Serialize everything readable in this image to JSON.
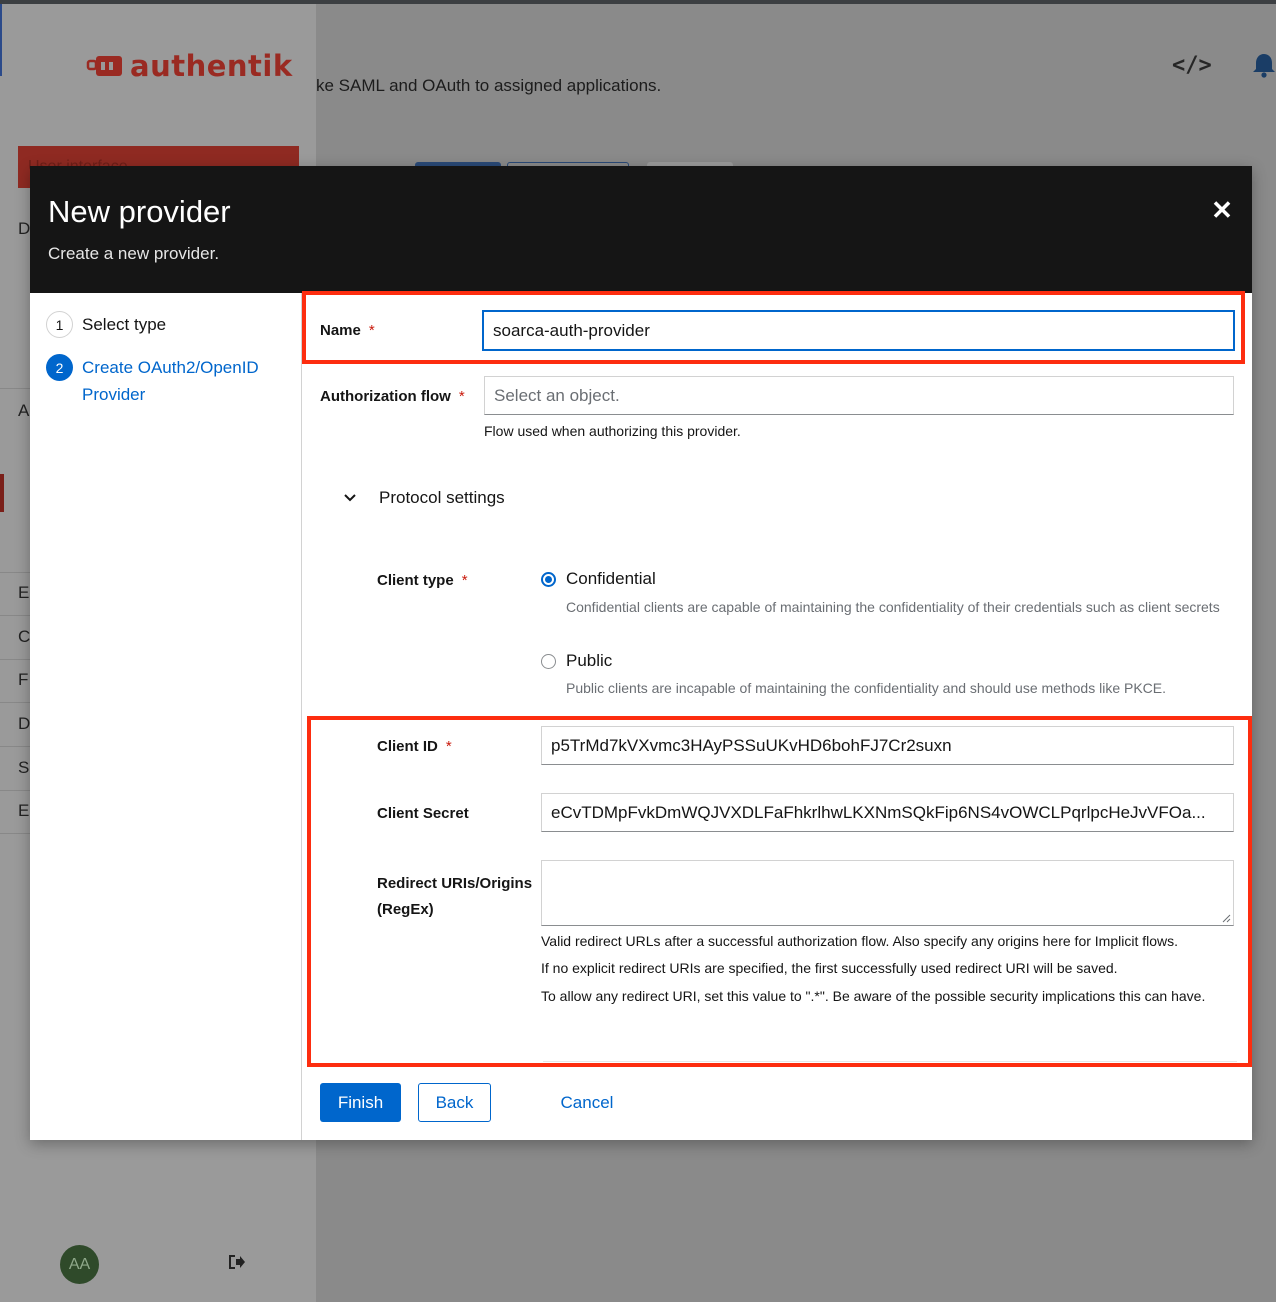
{
  "brand": {
    "name": "authentik",
    "accent": "#fd2d0f"
  },
  "background": {
    "page_subtitle": "ke SAML and OAuth to assigned applications.",
    "interface_button": "User interface",
    "sidebar_letters": [
      "D",
      "A",
      "E",
      "C",
      "F",
      "D",
      "S",
      "E"
    ],
    "user_initials": "AA",
    "icons": [
      "code-icon",
      "bell-icon",
      "logout-icon"
    ]
  },
  "modal": {
    "title": "New provider",
    "description": "Create a new provider.",
    "close_icon": "close-icon",
    "steps": [
      {
        "number": "1",
        "label": "Select type",
        "state": "done"
      },
      {
        "number": "2",
        "label": "Create OAuth2/OpenID Provider",
        "state": "current"
      }
    ],
    "form": {
      "name": {
        "label": "Name",
        "required": "*",
        "value": "soarca-auth-provider"
      },
      "authorization_flow": {
        "label": "Authorization flow",
        "required": "*",
        "placeholder": "Select an object.",
        "helper": "Flow used when authorizing this provider."
      },
      "protocol_settings": {
        "label": "Protocol settings",
        "expanded": true
      },
      "client_type": {
        "label": "Client type",
        "required": "*",
        "options": [
          {
            "label": "Confidential",
            "description": "Confidential clients are capable of maintaining the confidentiality of their credentials such as client secrets",
            "selected": true
          },
          {
            "label": "Public",
            "description": "Public clients are incapable of maintaining the confidentiality and should use methods like PKCE.",
            "selected": false
          }
        ]
      },
      "client_id": {
        "label": "Client ID",
        "required": "*",
        "value": "p5TrMd7kVXvmc3HAyPSSuUKvHD6bohFJ7Cr2suxn"
      },
      "client_secret": {
        "label": "Client Secret",
        "value": "eCvTDMpFvkDmWQJVXDLFaFhkrlhwLKXNmSQkFip6NS4vOWCLPqrlpcHeJvVFOa..."
      },
      "redirect_uris": {
        "label_line1": "Redirect URIs/Origins",
        "label_line2": "(RegEx)",
        "value": "",
        "helpers": [
          "Valid redirect URLs after a successful authorization flow. Also specify any origins here for Implicit flows.",
          "If no explicit redirect URIs are specified, the first successfully used redirect URI will be saved.",
          "To allow any redirect URI, set this value to \".*\". Be aware of the possible security implications this can have."
        ]
      }
    },
    "buttons": {
      "finish": "Finish",
      "back": "Back",
      "cancel": "Cancel"
    }
  }
}
